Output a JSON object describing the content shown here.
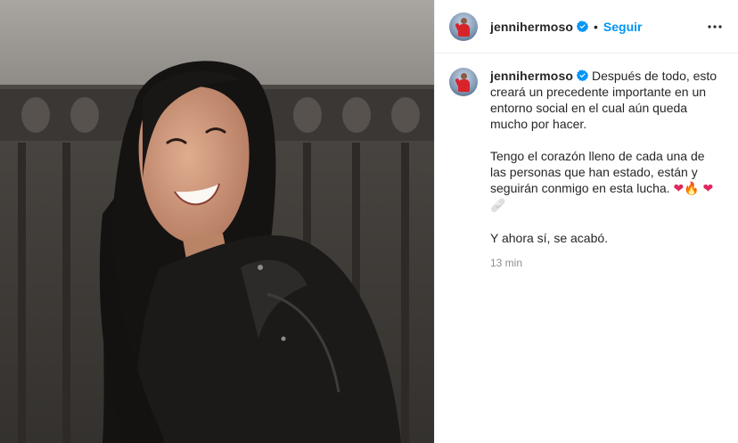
{
  "post": {
    "username": "jennihermoso",
    "follow_label": "Seguir",
    "separator": "•",
    "caption": {
      "intro": "Después de todo, esto creará un precedente importante en un entorno social en el cual aún queda mucho por hacer.",
      "para2": "Tengo el corazón lleno de cada una de las personas que han estado, están y seguirán conmigo en esta lucha.",
      "emoji_heart": "❤",
      "emoji_fire": "🔥",
      "emoji_bandage": "🩹",
      "para3": "Y ahora sí, se acabó."
    },
    "timestamp": "13 min"
  },
  "icons": {
    "verified": "verified-badge-icon",
    "more": "more-options-icon"
  },
  "colors": {
    "accent": "#0095f6",
    "verified": "#0095f6",
    "heart": "#e0245e"
  }
}
